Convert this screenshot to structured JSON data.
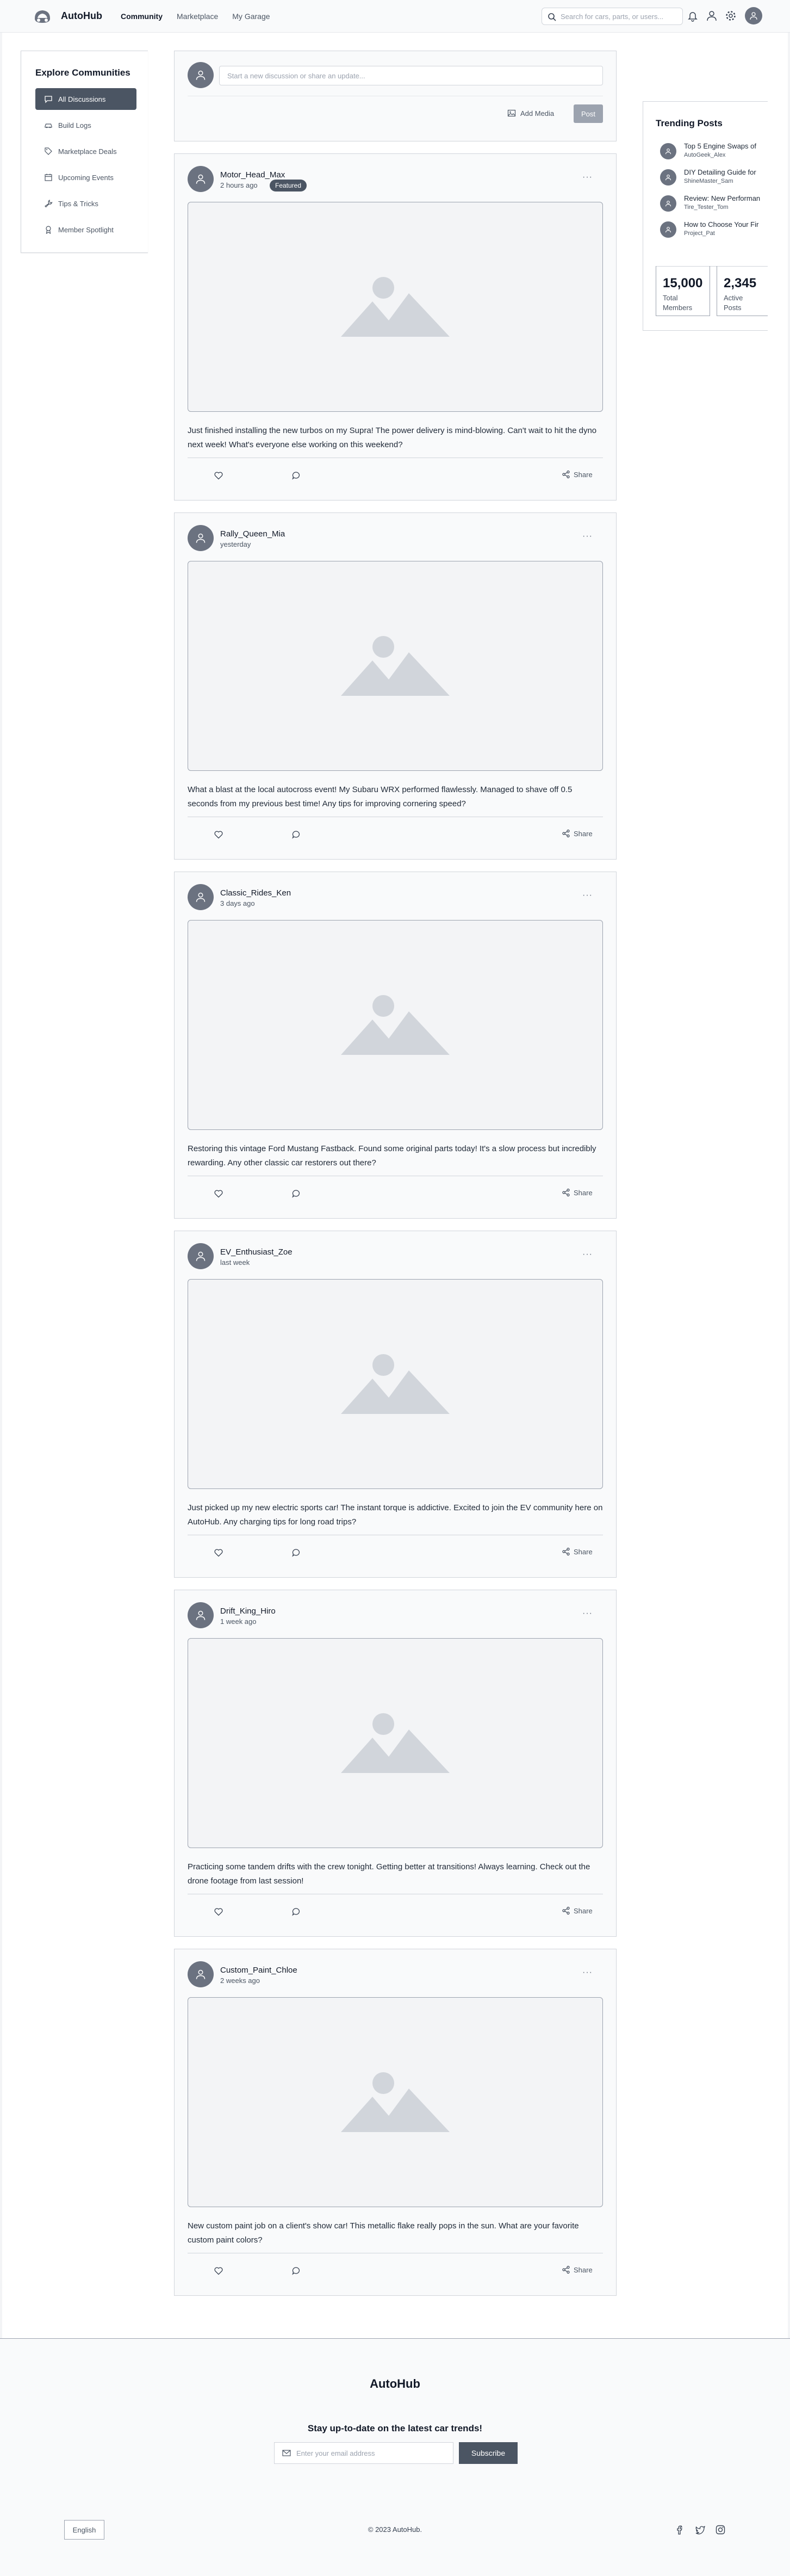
{
  "app": {
    "brand": "AutoHub"
  },
  "header": {
    "nav": [
      "Community",
      "Marketplace",
      "My Garage"
    ],
    "search_placeholder": "Search for cars, parts, or users..."
  },
  "sidebar": {
    "title": "Explore Communities",
    "items": [
      {
        "label": "All Discussions",
        "icon": "chat-icon"
      },
      {
        "label": "Build Logs",
        "icon": "car-icon"
      },
      {
        "label": "Marketplace Deals",
        "icon": "tag-icon"
      },
      {
        "label": "Upcoming Events",
        "icon": "calendar-icon"
      },
      {
        "label": "Tips & Tricks",
        "icon": "wrench-icon"
      },
      {
        "label": "Member Spotlight",
        "icon": "award-icon"
      }
    ]
  },
  "composer": {
    "placeholder": "Start a new discussion or share an update...",
    "add_media": "Add Media",
    "post": "Post"
  },
  "posts": [
    {
      "user": "Motor_Head_Max",
      "time": "2 hours ago",
      "badge": "Featured",
      "text": "Just finished installing the new turbos on my Supra! The power delivery is mind-blowing. Can't wait to hit the dyno next week! What's everyone else working on this weekend?",
      "share": "Share"
    },
    {
      "user": "Rally_Queen_Mia",
      "time": "yesterday",
      "text": "What a blast at the local autocross event! My Subaru WRX performed flawlessly. Managed to shave off 0.5 seconds from my previous best time! Any tips for improving cornering speed?",
      "share": "Share"
    },
    {
      "user": "Classic_Rides_Ken",
      "time": "3 days ago",
      "text": "Restoring this vintage Ford Mustang Fastback. Found some original parts today! It's a slow process but incredibly rewarding. Any other classic car restorers out there?",
      "share": "Share"
    },
    {
      "user": "EV_Enthusiast_Zoe",
      "time": "last week",
      "text": "Just picked up my new electric sports car! The instant torque is addictive. Excited to join the EV community here on AutoHub. Any charging tips for long road trips?",
      "share": "Share"
    },
    {
      "user": "Drift_King_Hiro",
      "time": "1 week ago",
      "text": "Practicing some tandem drifts with the crew tonight. Getting better at transitions! Always learning. Check out the drone footage from last session!",
      "share": "Share"
    },
    {
      "user": "Custom_Paint_Chloe",
      "time": "2 weeks ago",
      "text": "New custom paint job on a client's show car! This metallic flake really pops in the sun. What are your favorite custom paint colors?",
      "share": "Share"
    }
  ],
  "trending": {
    "title": "Trending Posts",
    "items": [
      {
        "title": "Top 5 Engine Swaps of",
        "author": "AutoGeek_Alex"
      },
      {
        "title": "DIY Detailing Guide for ",
        "author": "ShineMaster_Sam"
      },
      {
        "title": "Review: New Performan",
        "author": "Tire_Tester_Tom"
      },
      {
        "title": "How to Choose Your Fir",
        "author": "Project_Pat"
      }
    ],
    "stats": [
      {
        "num": "15,000",
        "label": "Total Members"
      },
      {
        "num": "2,345",
        "label": "Active Posts"
      }
    ]
  },
  "footer": {
    "brand": "AutoHub",
    "cta": "Stay up-to-date on the latest car trends!",
    "email_placeholder": "Enter your email address",
    "subscribe": "Subscribe",
    "language": "English",
    "copyright": "© 2023 AutoHub."
  }
}
